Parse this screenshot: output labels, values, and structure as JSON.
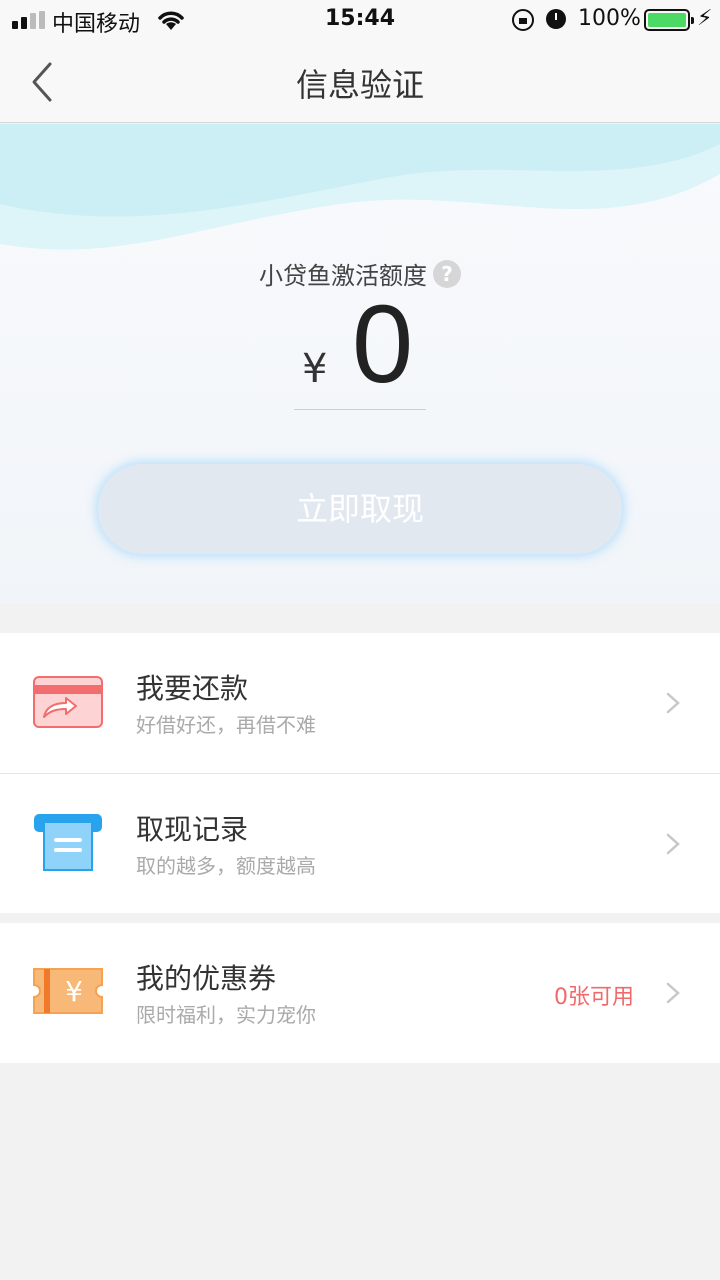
{
  "status_bar": {
    "carrier": "中国移动",
    "time": "15:44",
    "battery_pct": "100%",
    "battery_level": 1.0,
    "battery_color": "#4cd964"
  },
  "nav": {
    "title": "信息验证",
    "back_icon": "chevron-left-icon"
  },
  "hero": {
    "quota_label": "小贷鱼激活额度",
    "help_icon_text": "?",
    "currency": "¥",
    "amount": "0",
    "withdraw_label": "立即取现"
  },
  "menu": [
    {
      "title": "我要还款",
      "subtitle": "好借好还，再借不难",
      "icon": "repay-card-icon",
      "color": "#f26d6d"
    },
    {
      "title": "取现记录",
      "subtitle": "取的越多，额度越高",
      "icon": "withdraw-record-icon",
      "color": "#2aa3ee"
    },
    {
      "title": "我的优惠券",
      "subtitle": "限时福利，实力宠你",
      "badge": "0张可用",
      "icon": "coupon-icon",
      "coupon_symbol": "¥",
      "color": "#f5a252"
    }
  ]
}
